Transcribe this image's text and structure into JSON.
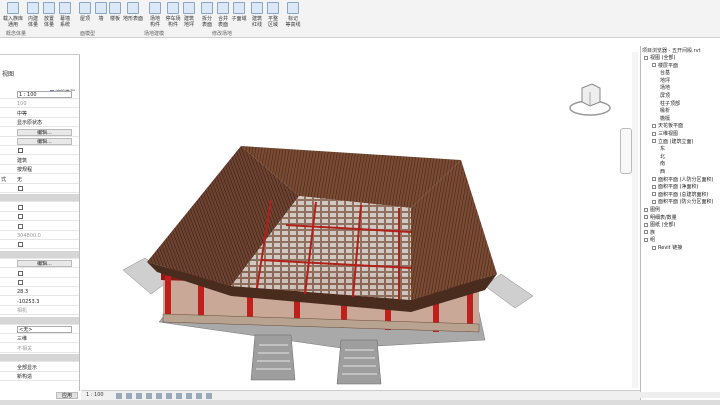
{
  "ribbon": {
    "buttons": [
      {
        "label": "载入族库\n通用",
        "icon": "family-icon"
      },
      {
        "label": "内建\n体量",
        "icon": "mass-icon"
      },
      {
        "label": "放置\n体量",
        "icon": "place-mass-icon"
      },
      {
        "label": "幕墙\n系统",
        "icon": "curtain-system-icon"
      },
      {
        "label": "屋顶",
        "icon": "roof-icon"
      },
      {
        "label": "墙",
        "icon": "wall-icon"
      },
      {
        "label": "楼板",
        "icon": "floor-icon"
      },
      {
        "label": "地形表面",
        "icon": "toposurface-icon"
      },
      {
        "label": "场地\n构件",
        "icon": "site-component-icon"
      },
      {
        "label": "停车场\n构件",
        "icon": "parking-icon"
      },
      {
        "label": "建筑\n地坪",
        "icon": "building-pad-icon"
      },
      {
        "label": "拆分\n表面",
        "icon": "split-surface-icon"
      },
      {
        "label": "合并\n表面",
        "icon": "merge-surface-icon"
      },
      {
        "label": "子面域",
        "icon": "subregion-icon"
      },
      {
        "label": "建筑\n红线",
        "icon": "property-line-icon"
      },
      {
        "label": "平整\n区域",
        "icon": "graded-region-icon"
      },
      {
        "label": "标记\n等高线",
        "icon": "label-contours-icon"
      }
    ],
    "groups": [
      "概念体量",
      "面模型",
      "场地建模",
      "修改场地"
    ],
    "group_arrow": "↘"
  },
  "properties": {
    "view_label": "视图",
    "edit_type": "编辑类型",
    "rows": [
      {
        "k": "",
        "v": "1 : 100",
        "style": "box"
      },
      {
        "k": "",
        "v": "100",
        "style": "gray"
      },
      {
        "k": "",
        "v": "中等",
        "style": ""
      },
      {
        "k": "",
        "v": "显示原状态",
        "style": ""
      },
      {
        "k": "",
        "v": "编辑...",
        "style": "btn"
      },
      {
        "k": "",
        "v": "编辑...",
        "style": "btn"
      },
      {
        "k": "",
        "v": "",
        "style": "check"
      },
      {
        "k": "",
        "v": "建筑",
        "style": ""
      },
      {
        "k": "",
        "v": "按规程",
        "style": ""
      },
      {
        "k": "式",
        "v": "无",
        "style": ""
      },
      {
        "k": "",
        "v": "",
        "style": "check"
      },
      {
        "k": "",
        "v": "",
        "style": "sec"
      },
      {
        "k": "",
        "v": "",
        "style": "check"
      },
      {
        "k": "",
        "v": "",
        "style": "check"
      },
      {
        "k": "",
        "v": "",
        "style": "check"
      },
      {
        "k": "",
        "v": "304800.0",
        "style": "gray"
      },
      {
        "k": "",
        "v": "",
        "style": "check"
      },
      {
        "k": "",
        "v": "",
        "style": "sec"
      },
      {
        "k": "",
        "v": "编辑...",
        "style": "btn"
      },
      {
        "k": "",
        "v": "",
        "style": "check"
      },
      {
        "k": "",
        "v": "",
        "style": "check"
      },
      {
        "k": "",
        "v": "28.3",
        "style": ""
      },
      {
        "k": "",
        "v": "-10253.3",
        "style": ""
      },
      {
        "k": "",
        "v": "相机",
        "style": "gray"
      },
      {
        "k": "",
        "v": "",
        "style": "sec"
      },
      {
        "k": "",
        "v": "<无>",
        "style": "box"
      },
      {
        "k": "",
        "v": "三维",
        "style": ""
      },
      {
        "k": "",
        "v": "不相关",
        "style": "gray"
      },
      {
        "k": "",
        "v": "",
        "style": "sec"
      },
      {
        "k": "",
        "v": "全部显示",
        "style": ""
      },
      {
        "k": "",
        "v": "新构造",
        "style": ""
      }
    ],
    "apply": "应用"
  },
  "browser": {
    "title": "项目浏览器 - 五开间殿.rvt",
    "items": [
      {
        "t": "视图 (全部)",
        "lvl": 0
      },
      {
        "t": "楼层平面",
        "lvl": 1
      },
      {
        "t": "台基",
        "lvl": 2
      },
      {
        "t": "地坪",
        "lvl": 2
      },
      {
        "t": "场地",
        "lvl": 2
      },
      {
        "t": "屏顶",
        "lvl": 2
      },
      {
        "t": "柱子顶部",
        "lvl": 2
      },
      {
        "t": "椽析",
        "lvl": 2
      },
      {
        "t": "檐檩",
        "lvl": 2
      },
      {
        "t": "天花板平面",
        "lvl": 1
      },
      {
        "t": "三维视图",
        "lvl": 1
      },
      {
        "t": "立面 (建筑立面)",
        "lvl": 1
      },
      {
        "t": "东",
        "lvl": 2
      },
      {
        "t": "北",
        "lvl": 2
      },
      {
        "t": "南",
        "lvl": 2
      },
      {
        "t": "西",
        "lvl": 2
      },
      {
        "t": "面积平面 (人防分区面积)",
        "lvl": 1
      },
      {
        "t": "面积平面 (净面积)",
        "lvl": 1
      },
      {
        "t": "面积平面 (总建筑面积)",
        "lvl": 1
      },
      {
        "t": "面积平面 (防火分区面积)",
        "lvl": 1
      },
      {
        "t": "图例",
        "lvl": 0
      },
      {
        "t": "明细表/数量",
        "lvl": 0
      },
      {
        "t": "图纸 (全部)",
        "lvl": 0
      },
      {
        "t": "族",
        "lvl": 0
      },
      {
        "t": "组",
        "lvl": 0
      },
      {
        "t": "Revit 链接",
        "lvl": 1
      }
    ]
  },
  "status": {
    "scale": "1 : 100"
  },
  "viewcube": {
    "label": "东"
  },
  "colors": {
    "roof": "#5a3a2a",
    "pillar": "#c0201c",
    "stone": "#b8b8b8"
  }
}
